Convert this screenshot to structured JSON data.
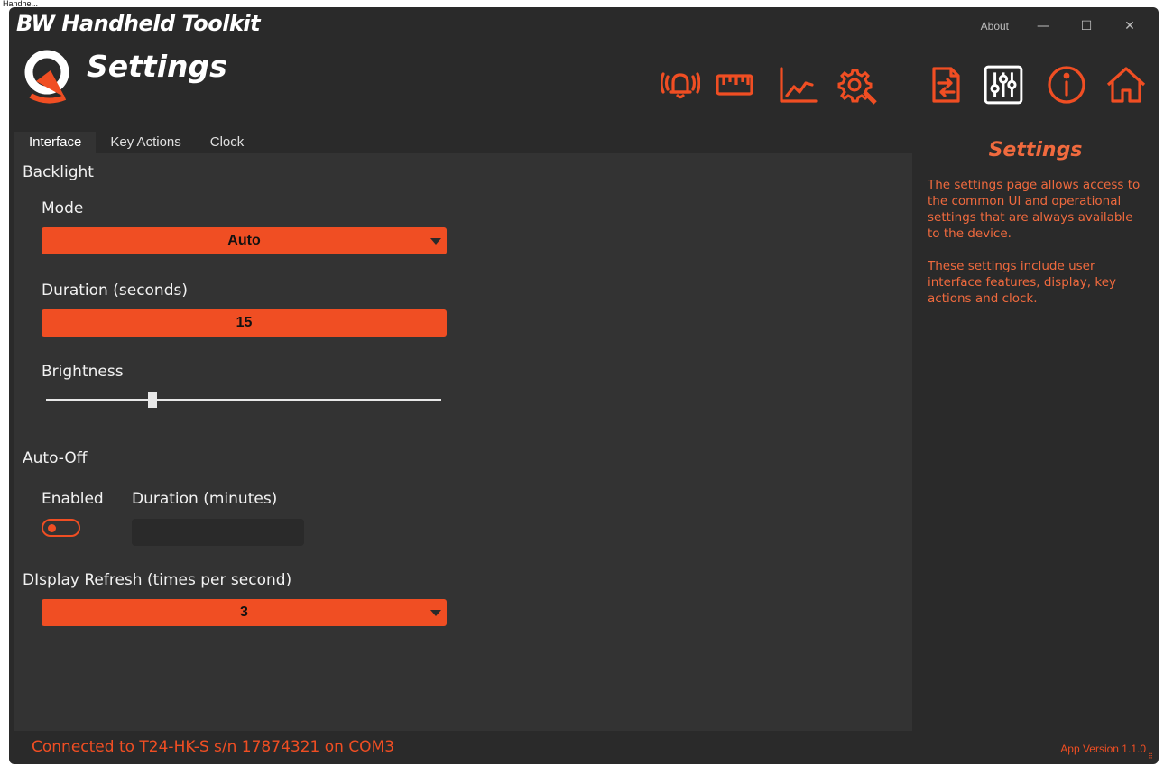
{
  "os_title": "Handhe...",
  "app": {
    "title": "BW Handheld Toolkit",
    "page_title": "Settings",
    "about_label": "About",
    "minimize_glyph": "—",
    "maximize_glyph": "☐",
    "close_glyph": "✕",
    "accent_color": "#f04e23"
  },
  "toolbar": {
    "icons": [
      "alarm-bell-icon",
      "ruler-icon",
      "chart-line-icon",
      "gear-wrench-icon",
      "file-transfer-icon",
      "sliders-icon",
      "info-icon",
      "home-icon"
    ],
    "active": "sliders-icon"
  },
  "tabs": [
    {
      "label": "Interface",
      "active": true
    },
    {
      "label": "Key Actions",
      "active": false
    },
    {
      "label": "Clock",
      "active": false
    }
  ],
  "interface": {
    "backlight_label": "Backlight",
    "mode_label": "Mode",
    "mode_value": "Auto",
    "duration_label": "Duration (seconds)",
    "duration_value": "15",
    "brightness_label": "Brightness",
    "brightness_fraction": 0.27,
    "auto_off_label": "Auto-Off",
    "enabled_label": "Enabled",
    "enabled_value": false,
    "auto_off_duration_label": "Duration (minutes)",
    "auto_off_duration_value": "",
    "refresh_label": "DIsplay Refresh (times per second)",
    "refresh_value": "3"
  },
  "side_panel": {
    "title": "Settings",
    "paragraph1": "The settings page allows access to the common UI and operational settings that are always available to the device.",
    "paragraph2": "These settings include user interface features, display, key actions and clock."
  },
  "status": {
    "connection_text": "Connected to T24-HK-S s/n 17874321 on COM3",
    "version_text": "App Version 1.1.0"
  }
}
